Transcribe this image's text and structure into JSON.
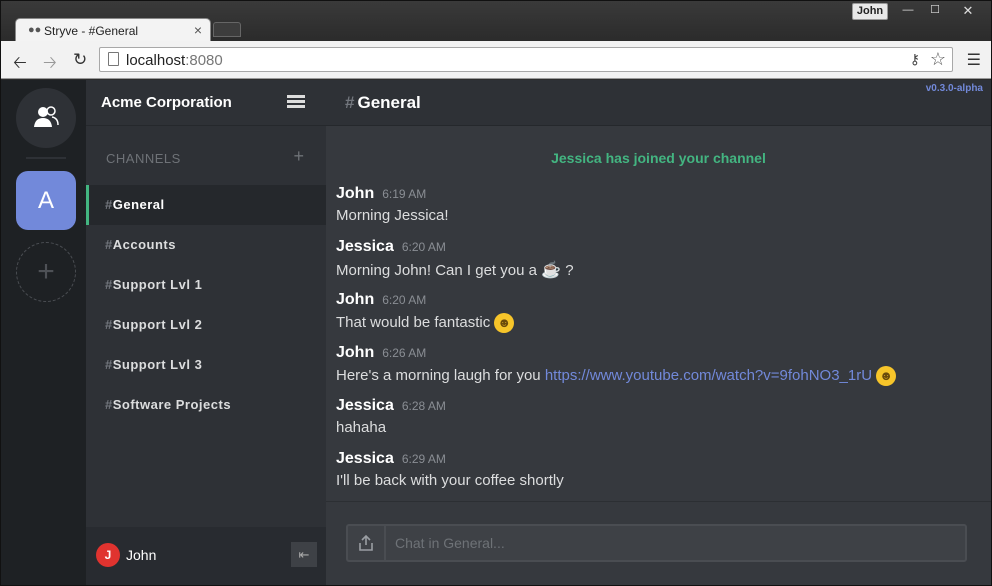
{
  "browser": {
    "tab_title": "Stryve - #General",
    "tab_close": "×",
    "profile_name": "John",
    "url_host": "localhost",
    "url_port": ":8080",
    "window_controls": {
      "minimize": "—",
      "maximize": "☐",
      "close": "✕"
    }
  },
  "rail": {
    "server_initial": "A",
    "add_server": "+"
  },
  "sidebar": {
    "server_name": "Acme Corporation",
    "channels_label": "CHANNELS",
    "add_channel": "+",
    "channels": [
      {
        "hash": "#",
        "name": "General"
      },
      {
        "hash": "#",
        "name": "Accounts"
      },
      {
        "hash": "#",
        "name": "Support Lvl 1"
      },
      {
        "hash": "#",
        "name": "Support Lvl 2"
      },
      {
        "hash": "#",
        "name": "Support Lvl 3"
      },
      {
        "hash": "#",
        "name": "Software Projects"
      }
    ],
    "user": {
      "initial": "J",
      "name": "John"
    }
  },
  "chat": {
    "hash": "#",
    "title": "General",
    "version": "v0.3.0-alpha",
    "join_notice": "Jessica has joined your channel",
    "messages": [
      {
        "author": "John",
        "time": "6:19 AM",
        "text": "Morning Jessica!"
      },
      {
        "author": "Jessica",
        "time": "6:20 AM",
        "text": "Morning John! Can I get you a",
        "suffix": "?"
      },
      {
        "author": "John",
        "time": "6:20 AM",
        "text": "That would be fantastic"
      },
      {
        "author": "John",
        "time": "6:26 AM",
        "text": "Here's a morning laugh for you",
        "link": "https://www.youtube.com/watch?v=9fohNO3_1rU"
      },
      {
        "author": "Jessica",
        "time": "6:28 AM",
        "text": "hahaha"
      },
      {
        "author": "Jessica",
        "time": "6:29 AM",
        "text": "I'll be back with your coffee shortly"
      }
    ],
    "input_placeholder": "Chat in General..."
  },
  "icons": {
    "coffee": "coffee-icon",
    "smile": "smile-emoji-icon"
  },
  "colors": {
    "accent": "#7289da",
    "online_green": "#43b581",
    "avatar_red": "#e0332f"
  }
}
